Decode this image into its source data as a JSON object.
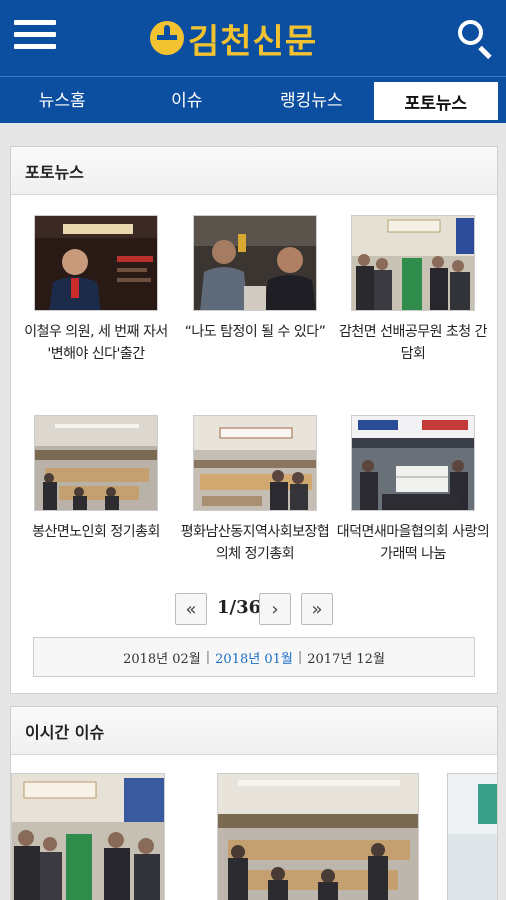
{
  "header": {
    "menu_icon": "hamburger-menu-icon",
    "logo_text": "김천신문",
    "search_icon": "search-icon",
    "brand_color": "#0c4fa0",
    "logo_color": "#f2c230"
  },
  "tabs": [
    {
      "label": "뉴스홈",
      "active": false
    },
    {
      "label": "이슈",
      "active": false
    },
    {
      "label": "랭킹뉴스",
      "active": false
    },
    {
      "label": "포토뉴스",
      "active": true
    }
  ],
  "photo_news": {
    "title": "포토뉴스",
    "items": [
      {
        "caption": "이철우 의원, 세 번째 자서 '변해야 신다'출간"
      },
      {
        "caption": "“나도 탐정이 될 수 있다”"
      },
      {
        "caption": "감천면 선배공무원 초청 간담회"
      },
      {
        "caption": "봉산면노인회 정기총회"
      },
      {
        "caption": "평화남산동지역사회보장협의체 정기총회"
      },
      {
        "caption": "대덕면새마을협의회 사랑의 가래떡 나눔"
      }
    ],
    "pager": {
      "first_icon": "double-chevron-left-icon",
      "first_label": "«",
      "page_text": "1/36",
      "next_icon": "chevron-right-icon",
      "next_label": "›",
      "last_icon": "double-chevron-right-icon",
      "last_label": "»"
    },
    "months": [
      {
        "label": "2018년 02월",
        "current": false
      },
      {
        "label": "2018년 01월",
        "current": true
      },
      {
        "label": "2017년 12월",
        "current": false
      }
    ],
    "month_separator": "|"
  },
  "issue_now": {
    "title": "이시간 이슈"
  }
}
